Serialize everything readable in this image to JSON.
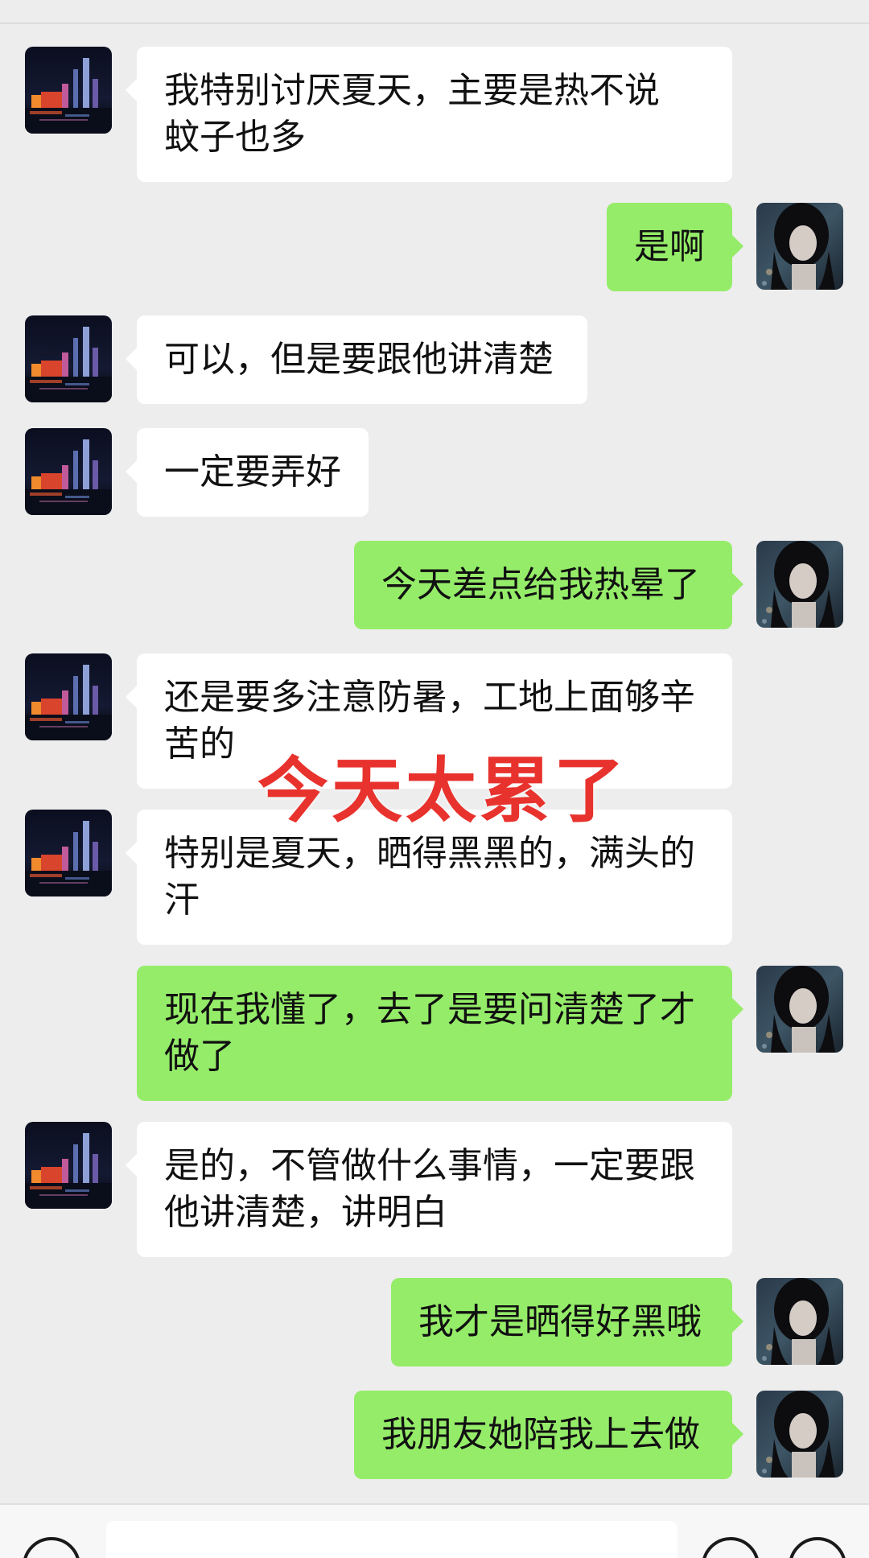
{
  "overlay_text": "今天太累了",
  "messages": [
    {
      "side": "left",
      "text": "我特别讨厌夏天，主要是热不说 蚊子也多"
    },
    {
      "side": "right",
      "text": "是啊"
    },
    {
      "side": "left",
      "text": "可以，但是要跟他讲清楚"
    },
    {
      "side": "left",
      "text": "一定要弄好"
    },
    {
      "side": "right",
      "text": "今天差点给我热晕了"
    },
    {
      "side": "left",
      "text": "还是要多注意防暑，工地上面够辛苦的"
    },
    {
      "side": "left",
      "text": "特别是夏天，晒得黑黑的，满头的汗"
    },
    {
      "side": "right",
      "text": "现在我懂了，去了是要问清楚了才做了"
    },
    {
      "side": "left",
      "text": "是的，不管做什么事情，一定要跟他讲清楚，讲明白"
    },
    {
      "side": "right",
      "text": "我才是晒得好黑哦"
    },
    {
      "side": "right",
      "text": "我朋友她陪我上去做"
    }
  ],
  "colors": {
    "background": "#ededed",
    "bubble_received": "#ffffff",
    "bubble_sent": "#95ec69",
    "overlay": "#e8322d"
  },
  "icons": {
    "left_avatar": "city-night-avatar",
    "right_avatar": "girl-portrait-avatar",
    "voice": "voice-icon",
    "emoji": "emoji-icon",
    "more": "plus-icon"
  }
}
